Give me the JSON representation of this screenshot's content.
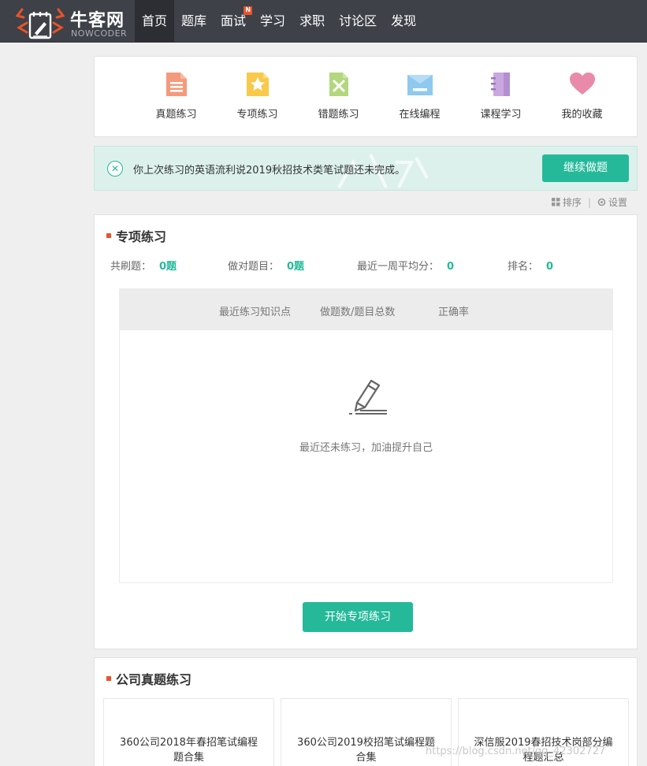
{
  "header": {
    "logo_cn": "牛客网",
    "logo_en": "NOWCODER",
    "nav": [
      {
        "label": "首页",
        "active": true
      },
      {
        "label": "题库"
      },
      {
        "label": "面试",
        "badge": "N"
      },
      {
        "label": "学习"
      },
      {
        "label": "求职"
      },
      {
        "label": "讨论区"
      },
      {
        "label": "发现"
      }
    ]
  },
  "quick_links": [
    {
      "label": "真题练习",
      "icon": "document-icon",
      "color": "#f49a7c"
    },
    {
      "label": "专项练习",
      "icon": "star-icon",
      "color": "#f8c94a"
    },
    {
      "label": "错题练习",
      "icon": "wrong-book-icon",
      "color": "#b3d77e"
    },
    {
      "label": "在线编程",
      "icon": "code-window-icon",
      "color": "#8fc9ef"
    },
    {
      "label": "课程学习",
      "icon": "notebook-icon",
      "color": "#c9a8e0"
    },
    {
      "label": "我的收藏",
      "icon": "heart-icon",
      "color": "#e98aab"
    }
  ],
  "notice": {
    "text": "你上次练习的英语流利说2019秋招技术类笔试题还未完成。",
    "button": "继续做题"
  },
  "tools": {
    "sort": "排序",
    "settings": "设置"
  },
  "special": {
    "title": "专项练习",
    "stats": [
      {
        "label": "共刷题：",
        "value": "0题"
      },
      {
        "label": "做对题目：",
        "value": "0题"
      },
      {
        "label": "最近一周平均分：",
        "value": "0"
      },
      {
        "label": "排名：",
        "value": "0"
      }
    ],
    "columns": [
      "最近练习知识点",
      "做题数/题目总数",
      "正确率"
    ],
    "empty_text": "最近还未练习，加油提升自己",
    "start_button": "开始专项练习"
  },
  "company": {
    "title": "公司真题练习",
    "cards": [
      "360公司2018年春招笔试编程题合集",
      "360公司2019校招笔试编程题合集",
      "深信服2019春招技术岗部分编程题汇总"
    ]
  },
  "watermark": "https://blog.csdn.net/qq_42302727",
  "colors": {
    "accent": "#25b99a",
    "brand": "#e8542b",
    "nav_bg": "#3e4148"
  }
}
